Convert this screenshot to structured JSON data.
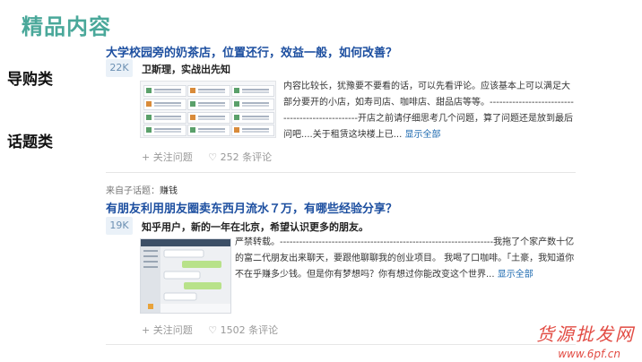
{
  "page_title": "精品内容",
  "side_labels": [
    "导购类",
    "话题类"
  ],
  "feed": [
    {
      "title": "大学校园旁的奶茶店，位置还行，效益一般，如何改善？",
      "votes": "22K",
      "author": "卫斯理，实战出先知",
      "excerpt": "内容比较长，犹豫要不要看的话，可以先看评论。应该基本上可以满足大部分要开的小店，如寿司店、咖啡店、甜品店等等。-------------------------------------------------开店之前请仔细思考几个问题，算了问题还是放到最后问吧....关于租赁这块楼上已...",
      "show_all": "显示全部",
      "follow": "+ 关注问题",
      "comments": "♡ 252 条评论"
    },
    {
      "topic_prefix": "来自子话题：",
      "topic": "赚钱",
      "title": "有朋友利用朋友圈卖东西月流水７万，有哪些经验分享？",
      "votes": "19K",
      "author": "知乎用户，新的一年在北京，希望认识更多的朋友。",
      "excerpt": "严禁转载。------------------------------------------------------------------我拖了个家产数十亿的富二代朋友出来聊天，要跟他聊聊我的创业项目。 我喝了口咖啡。「土豪，我知道你不在乎赚多少钱。但是你有梦想吗？你有想过你能改变这个世界...",
      "show_all": "显示全部",
      "follow": "+ 关注问题",
      "comments": "♡ 1502 条评论"
    }
  ],
  "watermark": "货源批发网",
  "watermark_url": "www.6pf.cn",
  "colors": {
    "title_teal": "#4aa89a",
    "link_blue": "#1d4fa0",
    "watermark_red": "#e24b43"
  }
}
